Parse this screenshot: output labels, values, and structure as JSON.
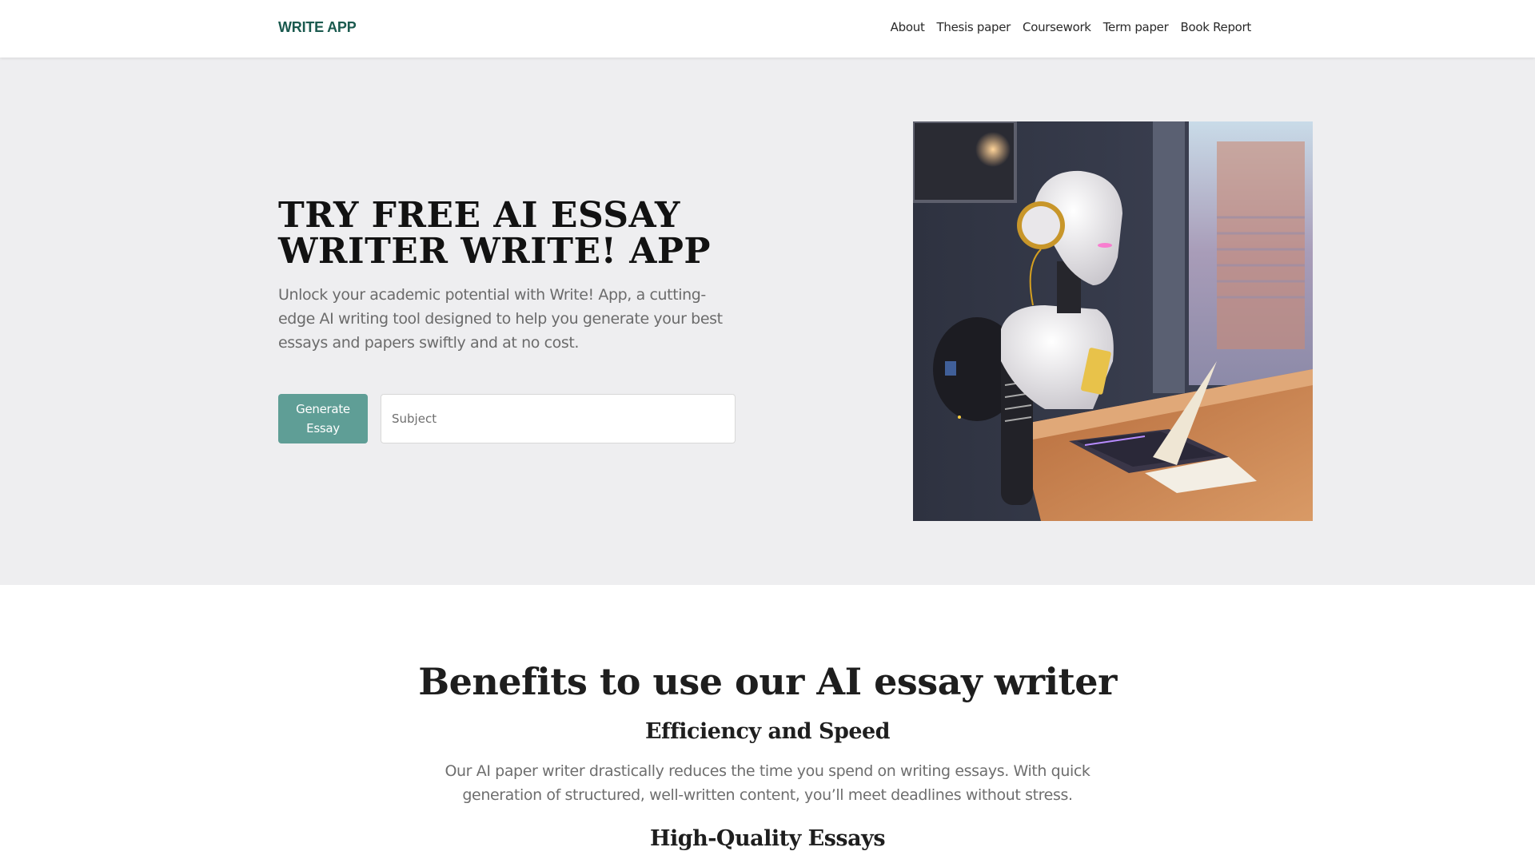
{
  "header": {
    "logo": "WRITE APP",
    "nav": [
      {
        "label": "About"
      },
      {
        "label": "Thesis paper"
      },
      {
        "label": "Coursework"
      },
      {
        "label": "Term paper"
      },
      {
        "label": "Book Report"
      }
    ]
  },
  "hero": {
    "title": "TRY FREE AI ESSAY WRITER WRITE! APP",
    "description": "Unlock your academic potential with Write! App, a cutting-edge AI writing tool designed to help you generate your best essays and papers swiftly and at no cost.",
    "generate_button": "Generate Essay",
    "subject_input": {
      "value": "",
      "placeholder": "Subject"
    },
    "image_alt": "Robot writing on a laptop at a desk by a window"
  },
  "benefits": {
    "title": "Benefits to use our AI essay writer",
    "items": [
      {
        "heading": "Efficiency and Speed",
        "text": "Our AI paper writer drastically reduces the time you spend on writing essays. With quick generation of structured, well-written content, you’ll meet deadlines without stress."
      },
      {
        "heading": "High-Quality Essays"
      }
    ]
  },
  "colors": {
    "brand": "#1b5a4f",
    "button": "#5f9e96",
    "hero_bg": "#eeeef0"
  }
}
